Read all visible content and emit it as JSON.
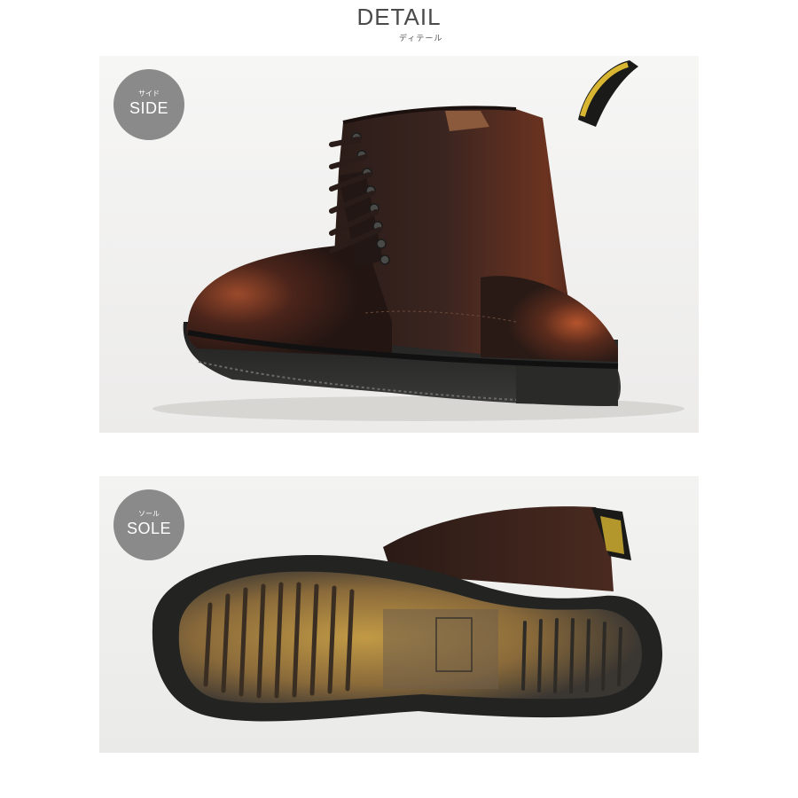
{
  "header": {
    "title": "DETAIL",
    "subtitle": "ディテール"
  },
  "panels": [
    {
      "badge_kana": "サイド",
      "badge_label": "SIDE"
    },
    {
      "badge_kana": "ソール",
      "badge_label": "SOLE"
    }
  ],
  "colors": {
    "background": "#ffffff",
    "panel": "#f4f4f3",
    "badge": "#8a8a8a",
    "leather_dark": "#2e1b16",
    "leather_light": "#8a3a22",
    "sole_tan": "#b08a3a",
    "pull_tab_yellow": "#d9b632"
  }
}
